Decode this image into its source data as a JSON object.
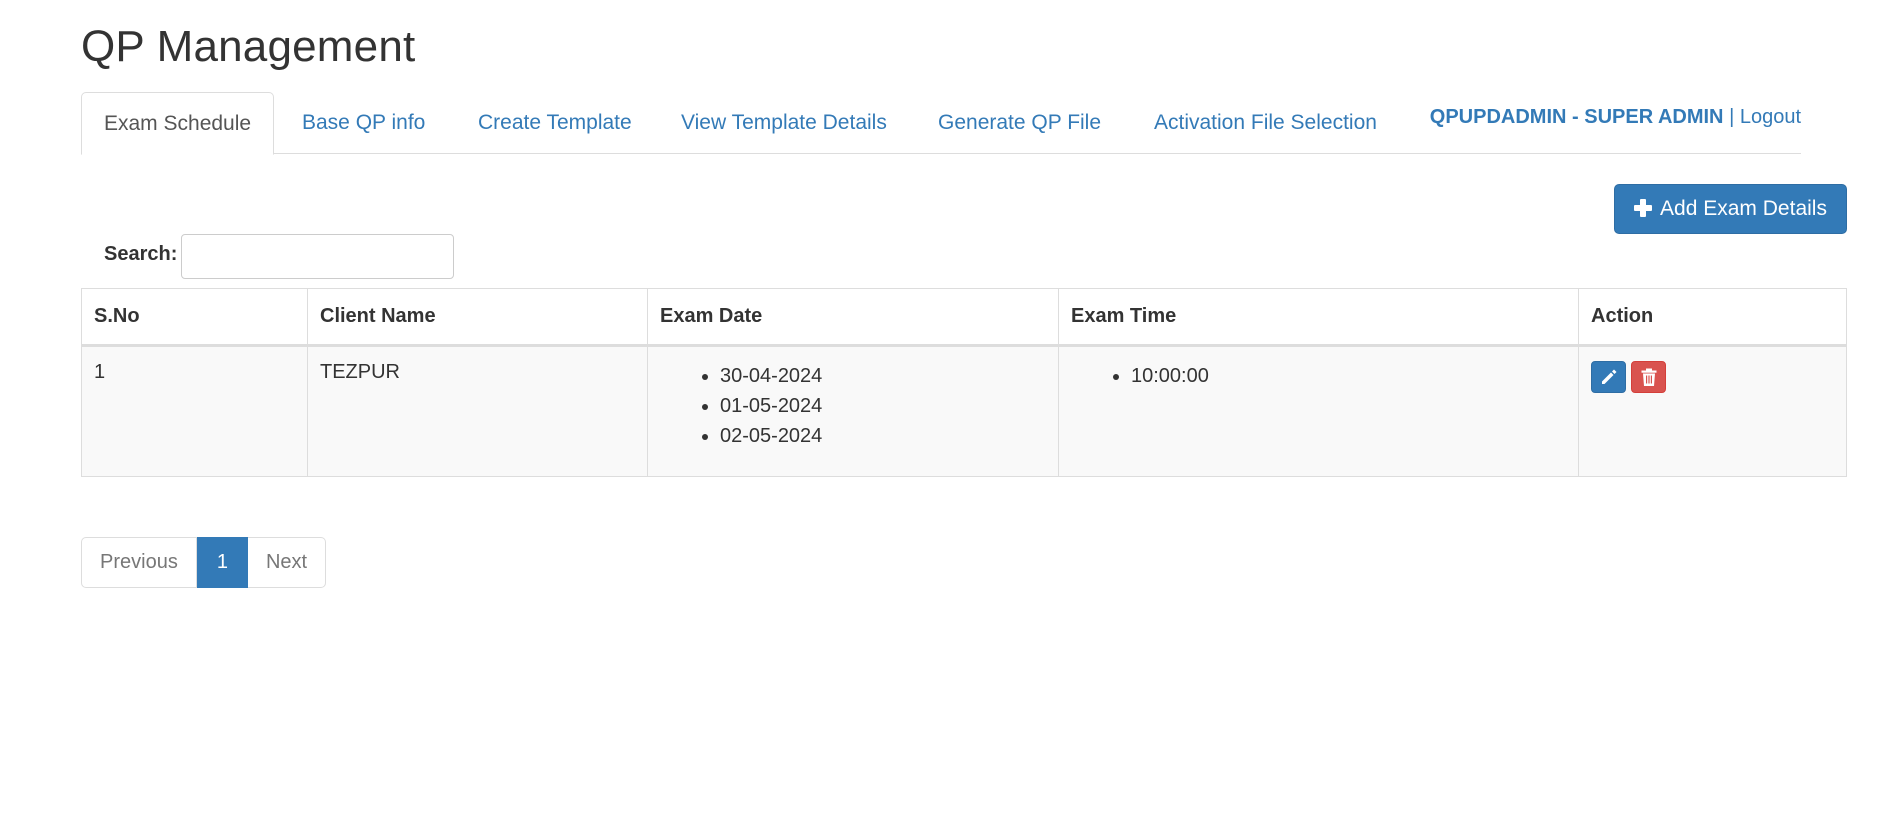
{
  "page": {
    "title": "QP Management"
  },
  "tabs": [
    {
      "label": "Exam Schedule",
      "active": true
    },
    {
      "label": "Base QP info"
    },
    {
      "label": "Create Template"
    },
    {
      "label": "View Template Details"
    },
    {
      "label": "Generate QP File"
    },
    {
      "label": "Activation File Selection"
    }
  ],
  "user": {
    "name": "QPUPDADMIN - SUPER ADMIN",
    "separator": "|",
    "logout": "Logout"
  },
  "toolbar": {
    "add_label": "Add Exam Details",
    "add_icon": "plus-icon"
  },
  "search": {
    "label": "Search:",
    "value": "",
    "placeholder": ""
  },
  "table": {
    "columns": [
      "S.No",
      "Client Name",
      "Exam Date",
      "Exam Time",
      "Action"
    ],
    "rows": [
      {
        "sno": "1",
        "client": "TEZPUR",
        "dates": [
          "30-04-2024",
          "01-05-2024",
          "02-05-2024"
        ],
        "times": [
          "10:00:00"
        ],
        "actions": [
          {
            "icon": "pencil-icon",
            "color": "#337ab7"
          },
          {
            "icon": "trash-icon",
            "color": "#d9534f"
          }
        ]
      }
    ]
  },
  "pagination": {
    "previous": "Previous",
    "current": "1",
    "next": "Next"
  },
  "colors": {
    "primary": "#337ab7",
    "danger": "#d9534f",
    "border": "#dddddd"
  }
}
